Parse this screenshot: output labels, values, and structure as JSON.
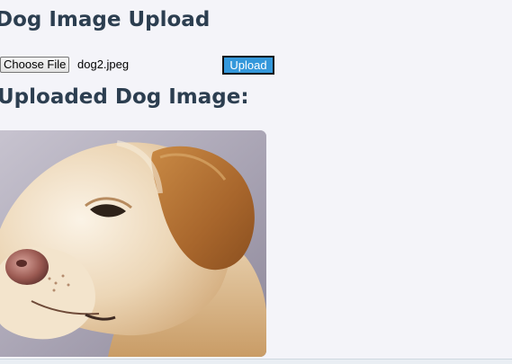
{
  "page": {
    "title": "Dog Image Upload",
    "subtitle": "Uploaded Dog Image:"
  },
  "upload": {
    "choose_label": "Choose File",
    "file_name": "dog2.jpeg",
    "upload_label": "Upload"
  },
  "image": {
    "subject": "yellow labrador retriever head in profile"
  },
  "colors": {
    "heading": "#2c3e50",
    "upload_button": "#3498db",
    "background": "#f4f4f9"
  }
}
